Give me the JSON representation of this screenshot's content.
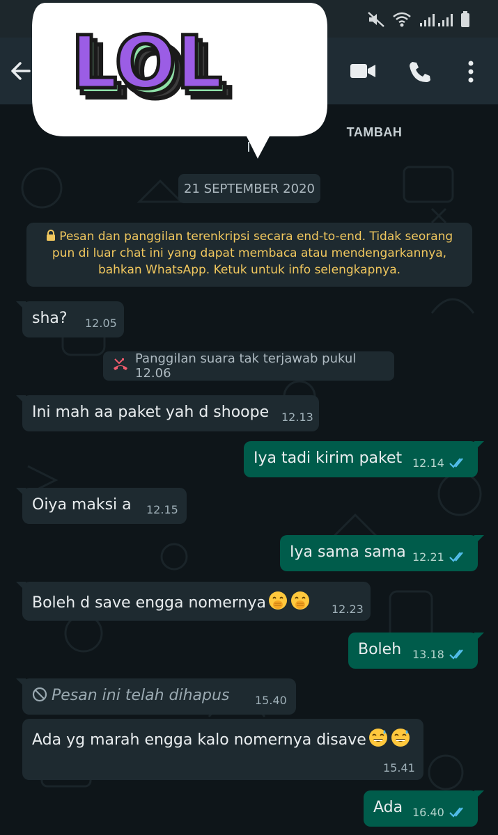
{
  "header": {
    "sticker_text": "LOL",
    "add_contact_label": "TAMBAH"
  },
  "chat": {
    "date_label": "21 SEPTEMBER 2020",
    "encryption_notice": "Pesan dan panggilan terenkripsi secara end-to-end. Tidak seorang pun di luar chat ini yang dapat membaca atau mendengarkannya, bahkan WhatsApp. Ketuk untuk info selengkapnya.",
    "missed_call": "Panggilan suara tak terjawab pukul 12.06",
    "messages": [
      {
        "dir": "in",
        "text": "sha?",
        "time": "12.05"
      },
      {
        "dir": "in",
        "text": "Ini mah aa paket yah d shoope",
        "time": "12.13"
      },
      {
        "dir": "out",
        "text": "Iya tadi kirim paket",
        "time": "12.14"
      },
      {
        "dir": "in",
        "text": "Oiya maksi a",
        "time": "12.15"
      },
      {
        "dir": "out",
        "text": "Iya sama sama",
        "time": "12.21"
      },
      {
        "dir": "in",
        "text": "Boleh d save engga nomernya",
        "time": "12.23",
        "emoji": "hand-over-mouth-face"
      },
      {
        "dir": "out",
        "text": "Boleh",
        "time": "13.18"
      },
      {
        "dir": "in",
        "text": "Pesan ini telah dihapus",
        "time": "15.40",
        "deleted": true
      },
      {
        "dir": "in",
        "text": "Ada yg marah engga kalo nomernya disave",
        "time": "15.41",
        "emoji": "sweat-smile-face"
      },
      {
        "dir": "out",
        "text": "Ada",
        "time": "16.40"
      }
    ]
  },
  "colors": {
    "incoming_bubble": "#1e2a30",
    "outgoing_bubble": "#005c4b",
    "read_ticks": "#53bdeb",
    "encryption_text": "#f0c75e"
  },
  "icons": [
    "mute-icon",
    "wifi-icon",
    "signal-icon",
    "battery-icon",
    "back-arrow-icon",
    "video-call-icon",
    "voice-call-icon",
    "more-options-icon",
    "lock-icon",
    "missed-call-icon",
    "deleted-icon",
    "double-check-icon"
  ]
}
